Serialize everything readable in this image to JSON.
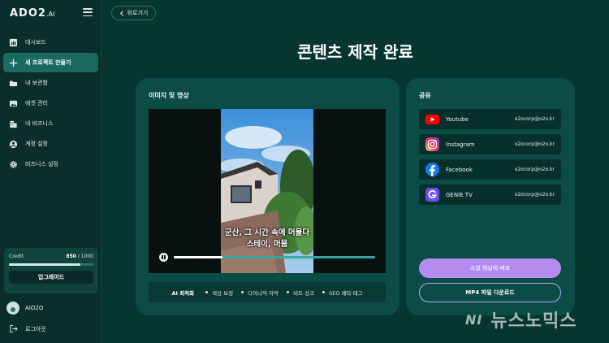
{
  "brand": {
    "logo": "ADO2",
    "logo_suffix": ".AI"
  },
  "sidebar": {
    "items": [
      {
        "label": "대시보드",
        "icon": "chart-icon"
      },
      {
        "label": "새 프로젝트 만들기",
        "icon": "plus-icon",
        "active": true
      },
      {
        "label": "내 보관함",
        "icon": "folder-icon"
      },
      {
        "label": "에셋 관리",
        "icon": "image-icon"
      },
      {
        "label": "내 비즈니스",
        "icon": "building-icon"
      },
      {
        "label": "계정 설정",
        "icon": "user-circle-icon"
      },
      {
        "label": "비즈니스 설정",
        "icon": "gear-icon"
      }
    ],
    "credit": {
      "label": "Credit",
      "used": "850",
      "separator": "/",
      "total": "1000",
      "fraction": 0.85
    },
    "upgrade_label": "업그레이드",
    "user_name": "AIO2O",
    "logout_label": "로그아웃"
  },
  "header": {
    "back_label": "뒤로가기"
  },
  "page_title": "콘텐츠 제작 완료",
  "media": {
    "title": "이미지 및 영상",
    "caption_line1": "군산, 그 시간 속에 머물다",
    "caption_line2": "스테이, 머뭄",
    "progress_fraction": 0.24,
    "features": [
      "AI 최적화",
      "색상 보정",
      "다이나믹 자막",
      "비트 싱크",
      "SEO 메타 태그"
    ]
  },
  "share": {
    "title": "공유",
    "channels": [
      {
        "name": "Youtube",
        "account": "o2ocorp@o2o.kr",
        "icon": "youtube-icon",
        "color": "#ff0000"
      },
      {
        "name": "Instagram",
        "account": "o2ocorp@o2o.kr",
        "icon": "instagram-icon",
        "color": "#e1306c"
      },
      {
        "name": "Facebook",
        "account": "o2ocorp@o2o.kr",
        "icon": "facebook-icon",
        "color": "#1877f2"
      },
      {
        "name": "GENIE TV",
        "account": "o2ocorp@o2o.kr",
        "icon": "genie-tv-icon",
        "color": "#6b4ef0"
      }
    ],
    "deploy_label": "소셜 채널에 배포",
    "mp4_label": "MP4 파일 다운로드"
  },
  "watermark": {
    "logo": "NI",
    "text": "뉴스노믹스"
  },
  "colors": {
    "accent": "#b48cf0",
    "panel": "#0b4c46",
    "active_nav": "#1b6a62"
  }
}
